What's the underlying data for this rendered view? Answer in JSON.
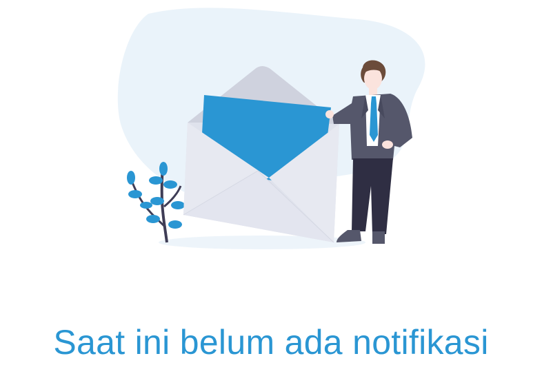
{
  "empty_state": {
    "illustration_icon": "empty-notification-envelope-illustration",
    "message": "Saat ini belum ada notifikasi"
  },
  "colors": {
    "accent": "#2a96d3",
    "blob": "#eaf3fa",
    "envelope": "#e3e5ef",
    "envelope_flap": "#cfd2de",
    "letter": "#2a96d3",
    "suit": "#3f3d56",
    "tie": "#2a96d3",
    "plant_leaf": "#2a96d3",
    "plant_stem": "#3f3d56"
  }
}
